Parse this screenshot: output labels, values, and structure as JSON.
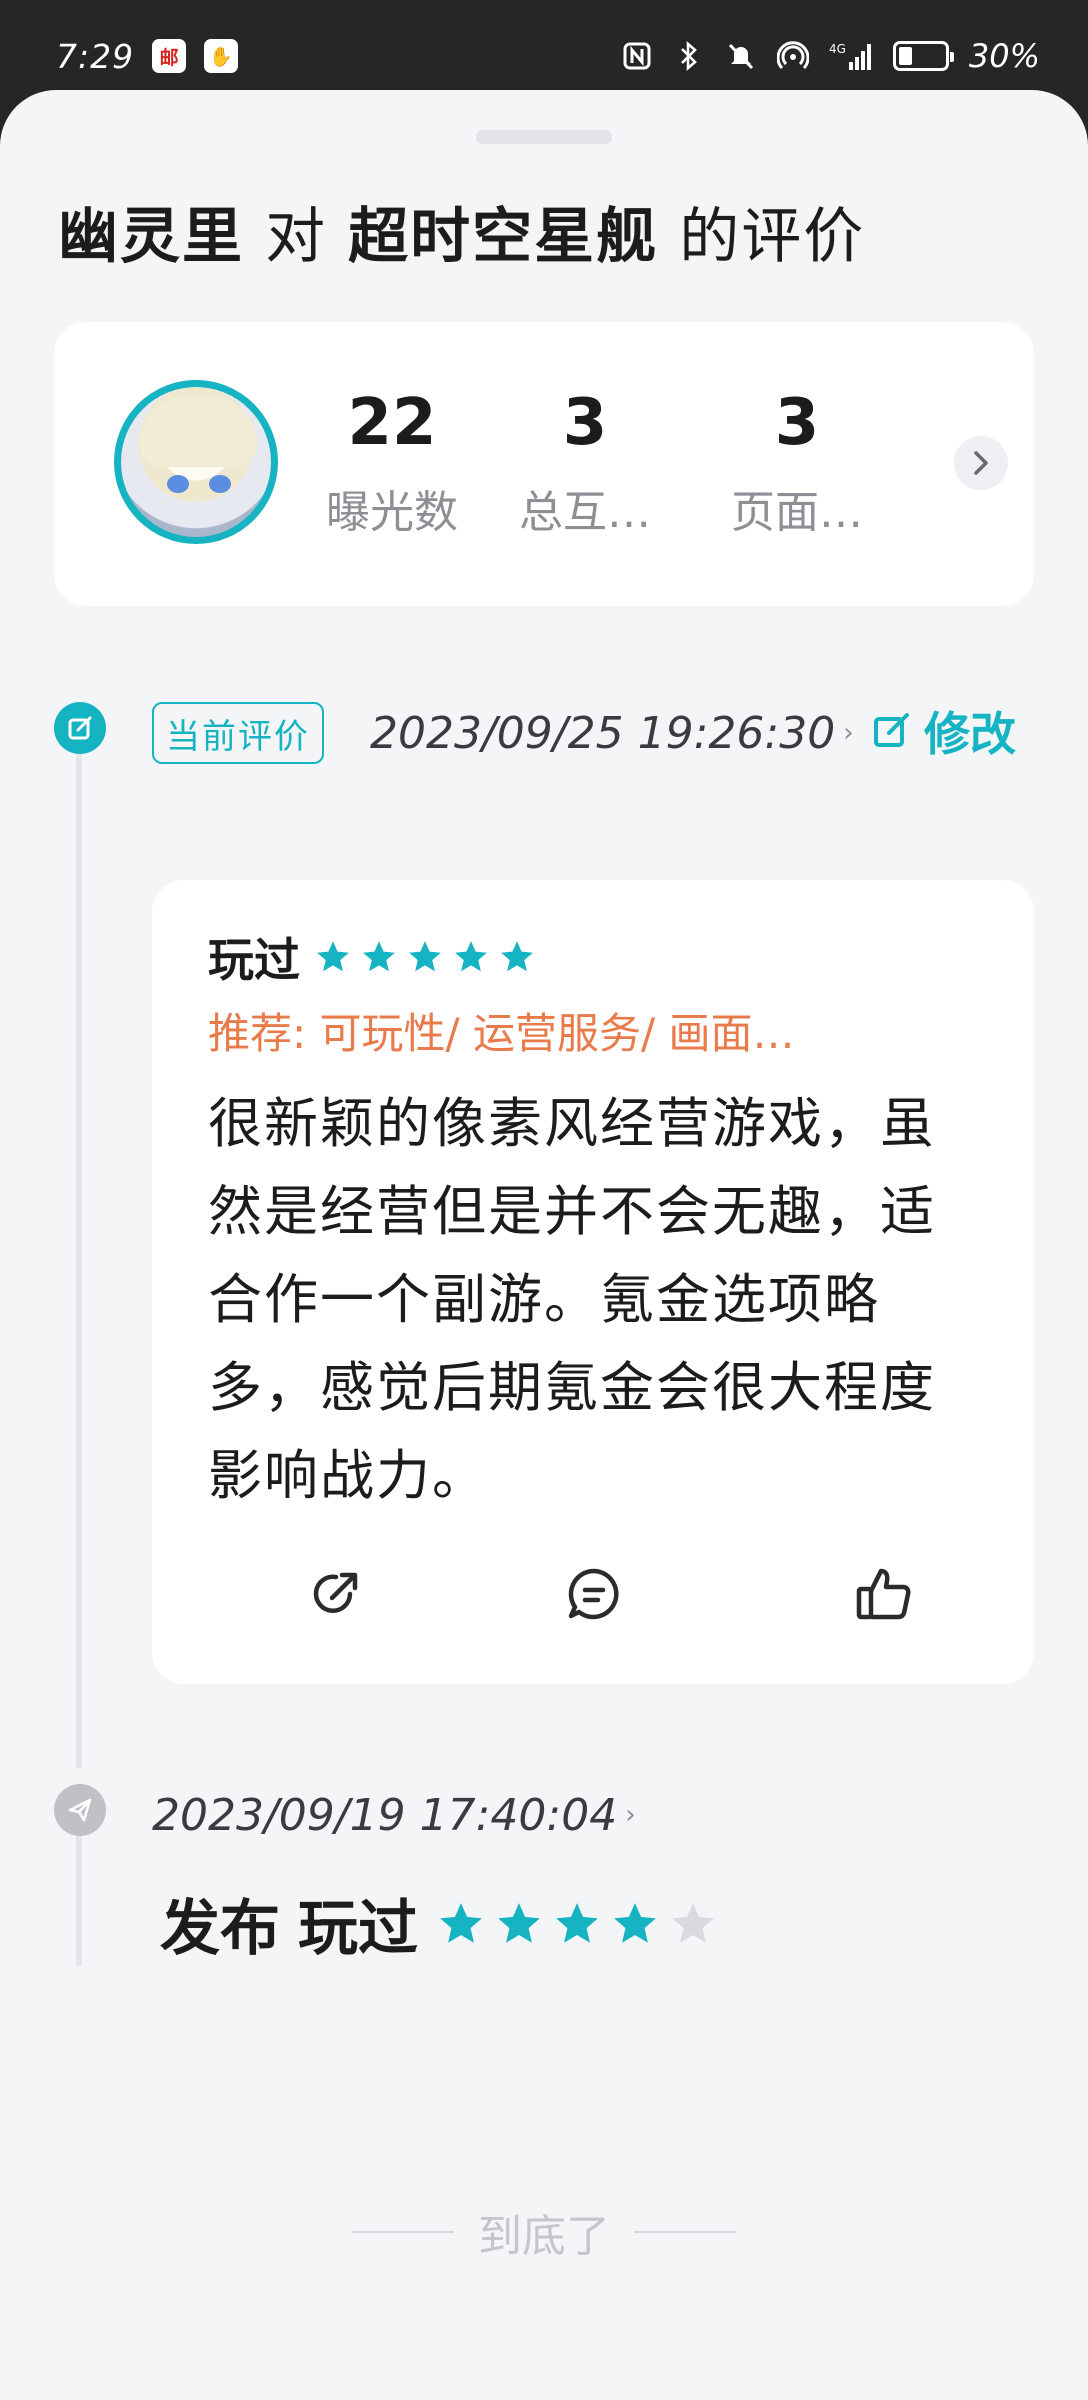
{
  "status_bar": {
    "time": "7:29",
    "app_badge_1": "邮",
    "app_badge_2": "✋",
    "network": "4G",
    "battery_percent": "30%",
    "battery_level": 0.3
  },
  "header": {
    "reviewer": "幽灵里",
    "connector": "对",
    "game": "超时空星舰",
    "suffix": "的评价"
  },
  "stats": [
    {
      "value": "22",
      "label": "曝光数"
    },
    {
      "value": "3",
      "label": "总互…"
    },
    {
      "value": "3",
      "label": "页面…"
    }
  ],
  "timeline": [
    {
      "badge": "当前评价",
      "date": "2023/09/25 19:26:30",
      "edit_label": "修改",
      "status": "玩过",
      "rating": 5,
      "tags": "推荐: 可玩性/ 运营服务/ 画面…",
      "content": "很新颖的像素风经营游戏，虽然是经营但是并不会无趣，适合作一个副游。氪金选项略多，感觉后期氪金会很大程度影响战力。"
    },
    {
      "date": "2023/09/19 17:40:04",
      "action": "发布",
      "status": "玩过",
      "rating": 4
    }
  ],
  "footer": {
    "end_text": "到底了"
  },
  "colors": {
    "accent": "#16b4c2",
    "tag": "#e97b4b",
    "star_off": "#d9dadd"
  },
  "icons": [
    "share-icon",
    "comment-icon",
    "like-icon",
    "edit-icon",
    "send-icon",
    "chevron-right-icon"
  ]
}
